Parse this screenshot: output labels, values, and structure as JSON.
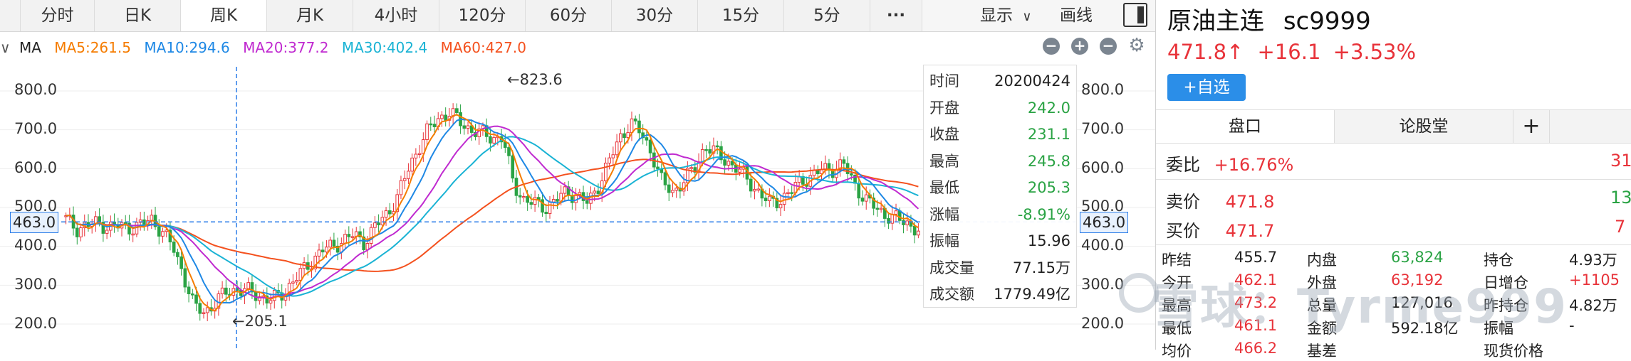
{
  "period_tabs": [
    "分时",
    "日K",
    "周K",
    "月K",
    "4小时",
    "120分",
    "60分",
    "30分",
    "15分",
    "5分"
  ],
  "active_tab": "周K",
  "more_label": "···",
  "display_label": "显示",
  "draw_label": "画线",
  "ma": {
    "label": "MA",
    "ma5": "MA5:261.5",
    "ma10": "MA10:294.6",
    "ma20": "MA20:377.2",
    "ma30": "MA30:402.4",
    "ma60": "MA60:427.0",
    "colors": {
      "ma5": "#f57c00",
      "ma10": "#1e88e5",
      "ma20": "#c02ad0",
      "ma30": "#1ab3d4",
      "ma60": "#f4511e"
    }
  },
  "chart_data": {
    "type": "candlestick",
    "yticks": [
      "800.0",
      "700.0",
      "600.0",
      "500.0",
      "400.0",
      "300.0",
      "200.0"
    ],
    "ylim": [
      170,
      860
    ],
    "high_marker": "←823.6",
    "low_marker": "←205.1",
    "crosshair_price": "463.0",
    "close_path": [
      470,
      445,
      455,
      460,
      450,
      452,
      448,
      455,
      470,
      440,
      400,
      330,
      245,
      230,
      255,
      282,
      290,
      285,
      275,
      262,
      270,
      300,
      330,
      360,
      390,
      400,
      415,
      430,
      410,
      450,
      480,
      520,
      590,
      650,
      700,
      730,
      745,
      720,
      700,
      690,
      680,
      680,
      560,
      520,
      510,
      500,
      520,
      540,
      530,
      510,
      560,
      620,
      680,
      720,
      690,
      640,
      560,
      540,
      570,
      600,
      660,
      640,
      620,
      600,
      570,
      540,
      510,
      520,
      540,
      570,
      580,
      598,
      600,
      610,
      560,
      520,
      500,
      480,
      470,
      460,
      440
    ]
  },
  "info": {
    "time_label": "时间",
    "time": "20200424",
    "open_label": "开盘",
    "open": "242.0",
    "close_label": "收盘",
    "close": "231.1",
    "high_label": "最高",
    "high": "245.8",
    "low_label": "最低",
    "low": "205.3",
    "change_label": "涨幅",
    "change": "-8.91%",
    "amp_label": "振幅",
    "amp": "15.96",
    "vol_label": "成交量",
    "vol": "77.15万",
    "amt_label": "成交额",
    "amt": "1779.49亿"
  },
  "quote": {
    "name": "原油主连",
    "code": "sc9999",
    "price": "471.8↑",
    "change": "+16.1",
    "change_pct": "+3.53%",
    "add_button": "+自选",
    "tabs": [
      "盘口",
      "论股堂"
    ],
    "plus": "+",
    "weibi_label": "委比",
    "weibi": "+16.76%",
    "weibi_right": "31",
    "sell_label": "卖价",
    "sell": "471.8",
    "sell_right": "13",
    "buy_label": "买价",
    "buy": "471.7",
    "buy_right": "7",
    "stats": [
      {
        "k1": "昨结",
        "v1": "455.7",
        "k2": "内盘",
        "v2": "63,824",
        "k3": "持仓",
        "v3": "4.93万"
      },
      {
        "k1": "今开",
        "v1": "462.1",
        "k2": "外盘",
        "v2": "63,192",
        "k3": "日增仓",
        "v3": "+1105"
      },
      {
        "k1": "最高",
        "v1": "473.2",
        "k2": "总量",
        "v2": "127,016",
        "k3": "昨持仓",
        "v3": "4.82万"
      },
      {
        "k1": "最低",
        "v1": "461.1",
        "k2": "金额",
        "v2": "592.18亿",
        "k3": "振幅",
        "v3": "-"
      },
      {
        "k1": "均价",
        "v1": "466.2",
        "k2": "基差",
        "v2": "",
        "k3": "现货价格",
        "v3": ""
      }
    ],
    "watermark": "雪球：Tyrme999"
  }
}
